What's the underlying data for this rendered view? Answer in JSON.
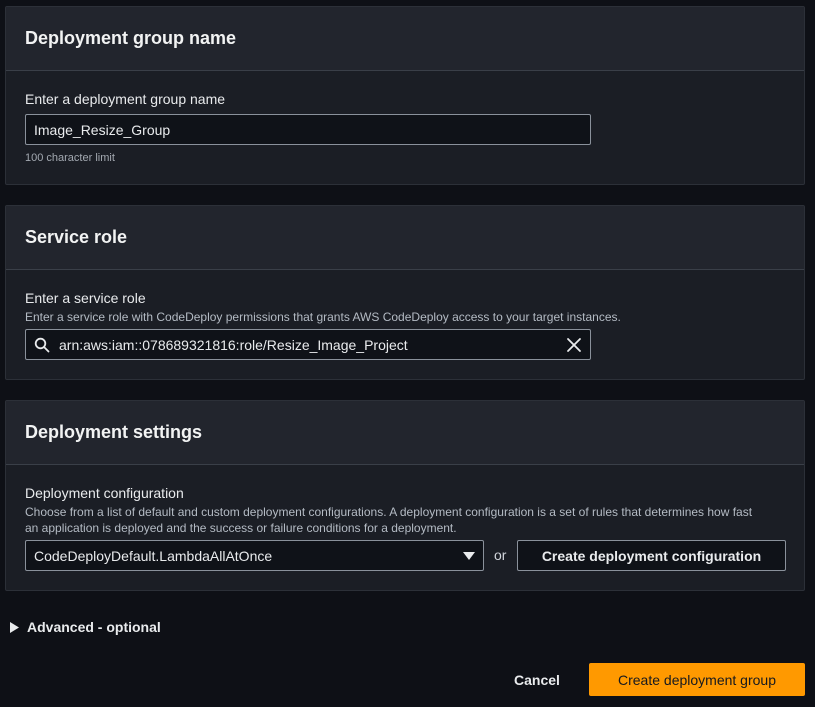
{
  "group_name_panel": {
    "title": "Deployment group name",
    "field_label": "Enter a deployment group name",
    "value": "Image_Resize_Group",
    "hint": "100 character limit"
  },
  "service_role_panel": {
    "title": "Service role",
    "field_label": "Enter a service role",
    "description": "Enter a service role with CodeDeploy permissions that grants AWS CodeDeploy access to your target instances.",
    "value": "arn:aws:iam::078689321816:role/Resize_Image_Project"
  },
  "deployment_settings_panel": {
    "title": "Deployment settings",
    "field_label": "Deployment configuration",
    "description_line1": "Choose from a list of default and custom deployment configurations. A deployment configuration is a set of rules that determines how fast",
    "description_line2": "an application is deployed and the success or failure conditions for a deployment.",
    "selected_config": "CodeDeployDefault.LambdaAllAtOnce",
    "or_text": "or",
    "create_config_label": "Create deployment configuration"
  },
  "advanced": {
    "label": "Advanced - optional"
  },
  "footer": {
    "cancel_label": "Cancel",
    "create_label": "Create deployment group"
  },
  "colors": {
    "primary_button": "#ff9900",
    "panel_bg": "#1b1e25",
    "page_bg": "#0e1016"
  },
  "icons": [
    "search-icon",
    "clear-icon",
    "caret-down-icon",
    "caret-right-icon"
  ]
}
